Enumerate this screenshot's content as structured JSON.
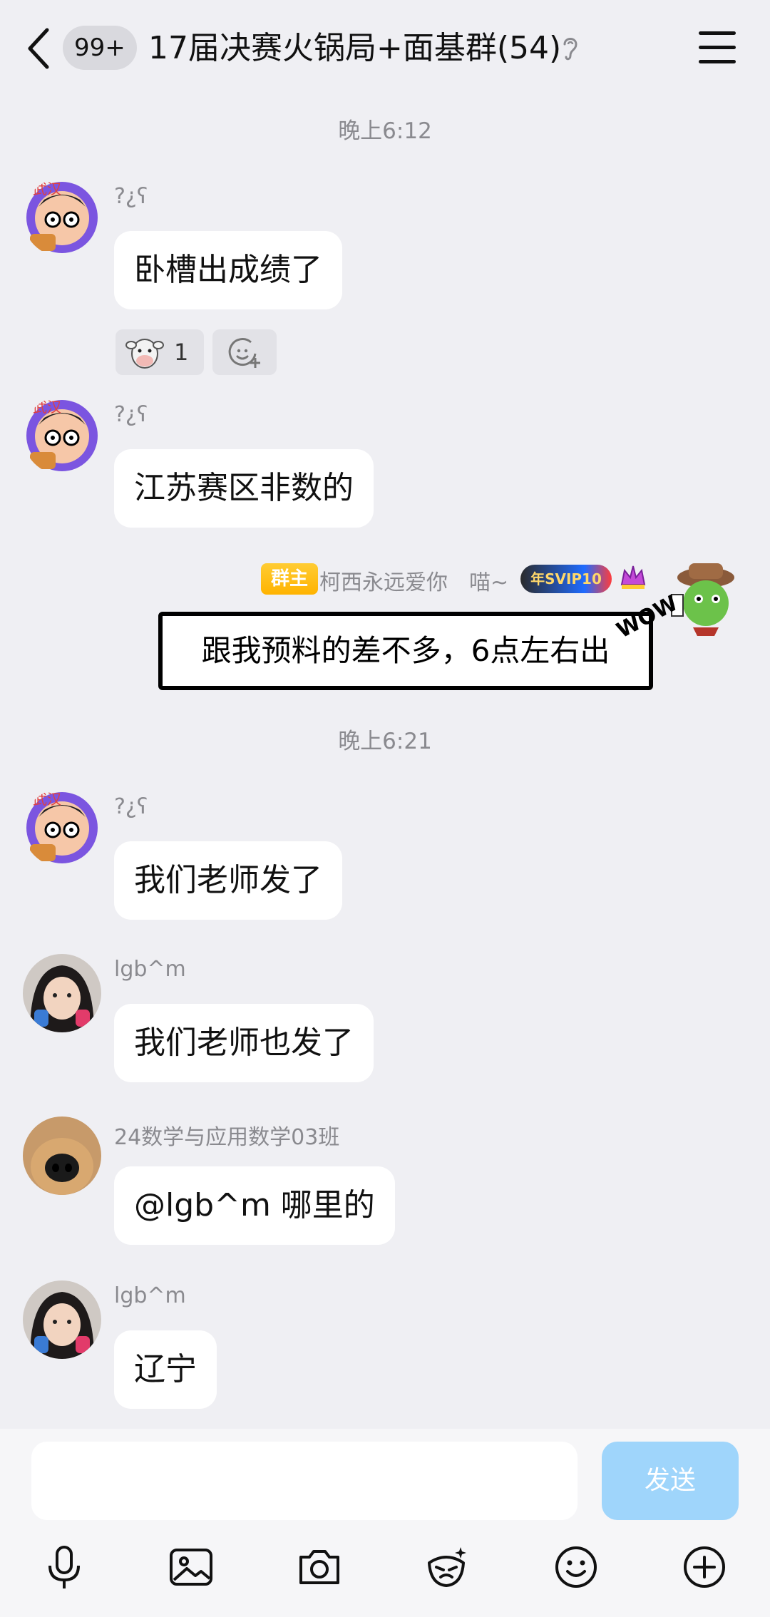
{
  "header": {
    "unread_badge": "99+",
    "title": "17届决赛火锅局+面基群(54)"
  },
  "messages": {
    "time1": "晚上6:12",
    "m1_nick": "?¿ʕ",
    "m1_text": "卧槽出成绩了",
    "m1_reaction_count": "1",
    "m2_nick": "?¿ʕ",
    "m2_text": "江苏赛区非数的",
    "owner_tag": "群主",
    "owner_name": "柯西永远爱你　喵~",
    "svip_label": "年SVIP10",
    "owner_text": "跟我预料的差不多，6点左右出",
    "wow": "WOW",
    "time2": "晚上6:21",
    "m3_nick": "?¿ʕ",
    "m3_text": "我们老师发了",
    "m4_nick": "lgb^m",
    "m4_text": "我们老师也发了",
    "m5_nick": "24数学与应用数学03班",
    "m5_text": "@lgb^m 哪里的",
    "m6_nick": "lgb^m",
    "m6_text": "辽宁"
  },
  "composer": {
    "send_label": "发送"
  },
  "colors": {
    "background": "#efeff3",
    "bubble": "#ffffff",
    "send_disabled": "#9fd5fb",
    "owner_tag": "#ffb300"
  },
  "icons": [
    "back-icon",
    "ear-icon",
    "menu-icon",
    "cow-emoji-icon",
    "add-reaction-icon",
    "microphone-icon",
    "image-icon",
    "camera-icon",
    "sticker-icon",
    "emoji-icon",
    "plus-icon"
  ]
}
